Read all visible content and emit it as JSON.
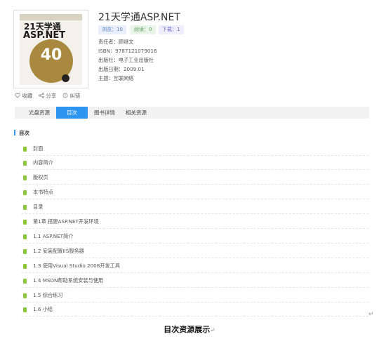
{
  "book": {
    "cover": {
      "title_line1": "21天学通",
      "title_line2": "ASP.NET",
      "number": "40"
    },
    "title": "21天学通ASP.NET",
    "stats": [
      {
        "label": "浏览：10"
      },
      {
        "label": "阅读：0"
      },
      {
        "label": "下载：1"
      }
    ],
    "meta": [
      "责任者：顾继文",
      "ISBN：9787121079016",
      "出版社：电子工业出版社",
      "出版日期：2009.01",
      "主题：互联网络"
    ]
  },
  "actions": [
    {
      "icon": "heart-icon",
      "label": "收藏"
    },
    {
      "icon": "share-icon",
      "label": "分享"
    },
    {
      "icon": "error-report-icon",
      "label": "纠错"
    }
  ],
  "tabs": [
    {
      "label": "光盘资源"
    },
    {
      "label": "目次"
    },
    {
      "label": "图书详情"
    },
    {
      "label": "相关资源"
    }
  ],
  "active_tab": "目次",
  "toc": {
    "heading": "目次",
    "items": [
      "封面",
      "内容简介",
      "版权页",
      "本书特点",
      "目录",
      "第1章 搭建ASP.NET开发环境",
      "1.1 ASP.NET简介",
      "1.2 安装配置IIS服务器",
      "1.3 使用Visual Studio 2008开发工具",
      "1.4 MSDN帮助系统安装与使用",
      "1.5 综合练习",
      "1.6 小结"
    ]
  },
  "paragraph_mark": "↵",
  "caption": "目次资源展示",
  "colors": {
    "accent": "#2d95f0",
    "toc_icon": "#8cc63f"
  }
}
